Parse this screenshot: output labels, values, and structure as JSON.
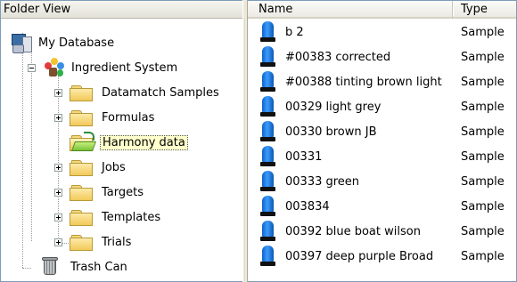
{
  "left_pane": {
    "header": "Folder View",
    "tree": {
      "root": "My Database",
      "system": "Ingredient System",
      "folders": [
        {
          "label": "Datamatch Samples",
          "expandable": true,
          "selected": false
        },
        {
          "label": "Formulas",
          "expandable": true,
          "selected": false
        },
        {
          "label": "Harmony data",
          "expandable": false,
          "selected": true
        },
        {
          "label": "Jobs",
          "expandable": true,
          "selected": false
        },
        {
          "label": "Targets",
          "expandable": true,
          "selected": false
        },
        {
          "label": "Templates",
          "expandable": true,
          "selected": false
        },
        {
          "label": "Trials",
          "expandable": true,
          "selected": false
        }
      ],
      "trash": "Trash Can"
    }
  },
  "right_pane": {
    "columns": {
      "name": "Name",
      "type": "Type"
    },
    "rows": [
      {
        "name": "b 2",
        "type": "Sample"
      },
      {
        "name": "#00383 corrected",
        "type": "Sample"
      },
      {
        "name": "#00388 tinting brown light",
        "type": "Sample"
      },
      {
        "name": "00329 light grey",
        "type": "Sample"
      },
      {
        "name": "00330 brown JB",
        "type": "Sample"
      },
      {
        "name": "00331",
        "type": "Sample"
      },
      {
        "name": "00333 green",
        "type": "Sample"
      },
      {
        "name": "003834",
        "type": "Sample"
      },
      {
        "name": "00392 blue boat wilson",
        "type": "Sample"
      },
      {
        "name": "00397 deep purple Broad",
        "type": "Sample"
      }
    ]
  },
  "icons": {
    "root": "database-computer-icon",
    "system": "ingredient-system-icon",
    "folder": "folder-icon",
    "open_folder": "open-folder-icon",
    "trash": "trash-can-icon",
    "sample": "sample-bottle-icon"
  },
  "colors": {
    "selection_bg": "#ffffcc",
    "sample_blue": "#1a78e6"
  }
}
